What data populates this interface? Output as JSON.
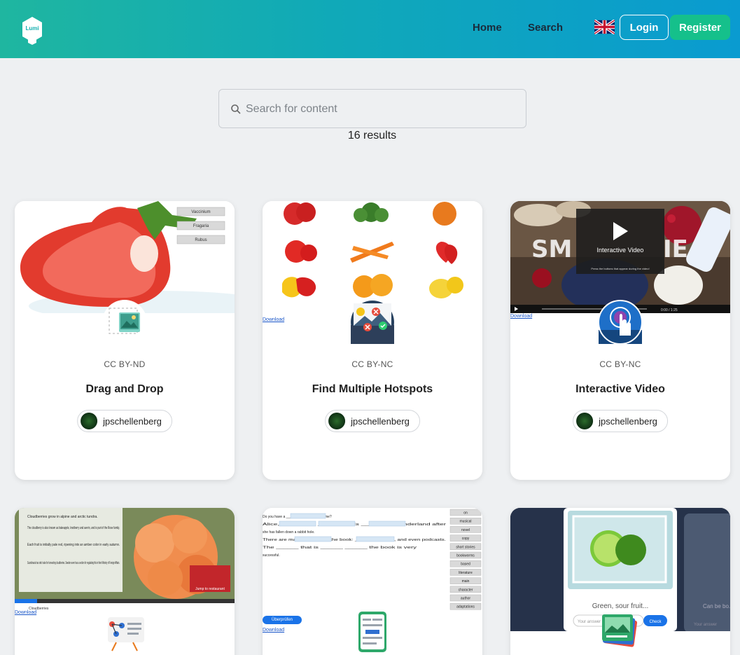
{
  "header": {
    "logo_text": "Lumi",
    "nav": {
      "home": "Home",
      "search": "Search"
    },
    "language_flag": "uk-flag-icon",
    "login": "Login",
    "register": "Register",
    "colors": {
      "gradient_start": "#1fb6a0",
      "gradient_end": "#0a9bd0",
      "register_bg": "#15c08b"
    }
  },
  "search": {
    "placeholder": "Search for content",
    "value": "",
    "results": "16 results"
  },
  "cards": [
    {
      "license": "CC BY-ND",
      "title": "Drag and Drop",
      "author": "jpschellenberg",
      "type_icon": "drag-drop-icon",
      "thumb_labels": [
        "Vaccinium",
        "Fragaria",
        "Rubus"
      ]
    },
    {
      "license": "CC BY-NC",
      "title": "Find Multiple Hotspots",
      "author": "jpschellenberg",
      "type_icon": "hotspots-icon",
      "download": "Download"
    },
    {
      "license": "CC BY-NC",
      "title": "Interactive Video",
      "author": "jpschellenberg",
      "type_icon": "interactive-video-icon",
      "download": "Download",
      "thumb_overlay_title": "Interactive Video",
      "thumb_overlay_sub": "Press the buttons that appear during the video!",
      "video_time": "0:00 / 1:25"
    },
    {
      "type_icon": "presentation-icon",
      "download": "Download",
      "thumb_bullets": [
        "Cloudberries grow in alpine and arctic tundra.",
        "The cloudberry is also known as bakeapple, knotberry and averin, and is part of the Rose family.",
        "Each fruit is initially pale red, ripening into an amber color in early autumn.",
        "Scandinavia has strict rules for harvesting cloudberries. Sweden even has a section for regulating this in their Ministry of Foreign Affairs."
      ],
      "thumb_jump": "Jump to restaurant",
      "thumb_slide_label": "Cloudberries"
    },
    {
      "type_icon": "drag-text-icon",
      "download": "Download",
      "check_label": "Überprüfen",
      "thumb_lines": [
        "Do you have a ______ of the book at home?",
        "Alice, the ______ ______, finds ______ in Wonderland after",
        "she has fallen down a rabbit hole.",
        "There are many ______ of the book: ______, comics, and even podcasts.",
        "The ______ that is ______ ______ the book is very",
        "successful."
      ],
      "thumb_words": [
        "on",
        "musical",
        "novel",
        "copy",
        "short stories",
        "bookworms",
        "based",
        "literature",
        "main",
        "character",
        "author",
        "adaptations"
      ]
    },
    {
      "type_icon": "flashcards-icon",
      "thumb_prompt": "Green, sour fruit...",
      "thumb_answer_placeholder": "Your answer",
      "thumb_check": "Check",
      "thumb_next_prompt": "Can be bo...",
      "thumb_next_answer": "Your answer"
    }
  ]
}
